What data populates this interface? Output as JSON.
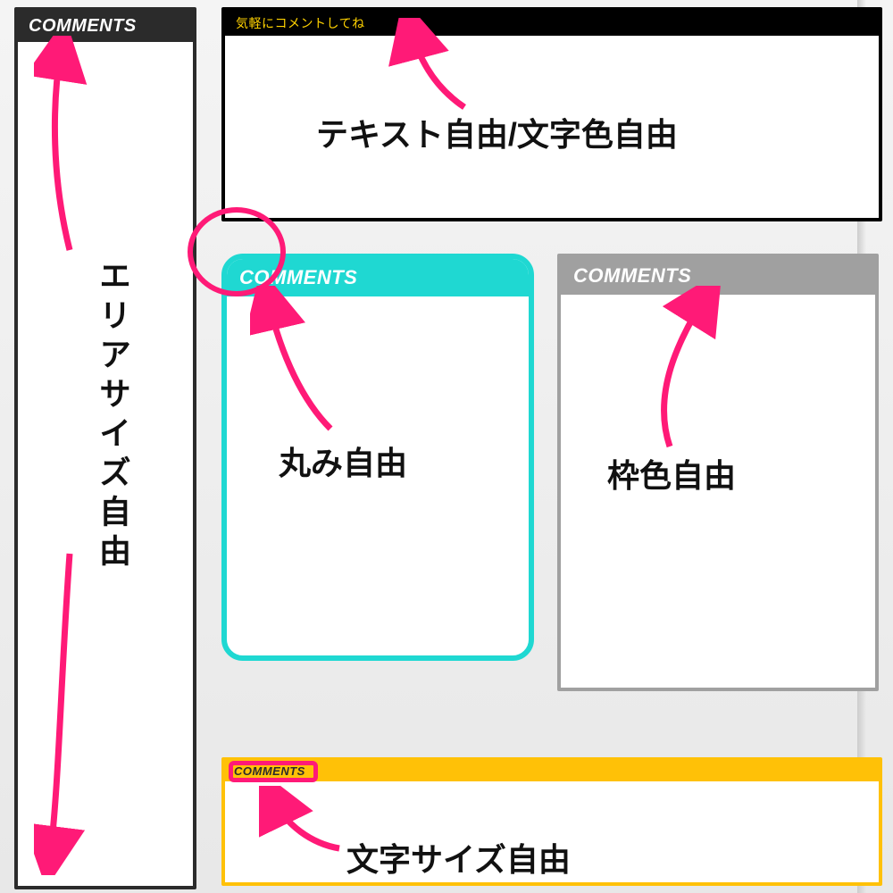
{
  "panels": {
    "p1": {
      "header": "COMMENTS"
    },
    "p2": {
      "header": "気軽にコメントしてね"
    },
    "p3": {
      "header": "COMMENTS"
    },
    "p4": {
      "header": "COMMENTS"
    },
    "p5": {
      "header": "COMMENTS"
    }
  },
  "annotations": {
    "area_size": "エリアサイズ自由",
    "text_color": "テキスト自由/文字色自由",
    "roundness": "丸み自由",
    "border_color": "枠色自由",
    "font_size": "文字サイズ自由"
  },
  "colors": {
    "pink": "#ff1a77",
    "cyan": "#1fd8d2",
    "yellow": "#ffc107",
    "grey": "#a0a0a0",
    "dark": "#2b2b2b",
    "black": "#000000"
  }
}
